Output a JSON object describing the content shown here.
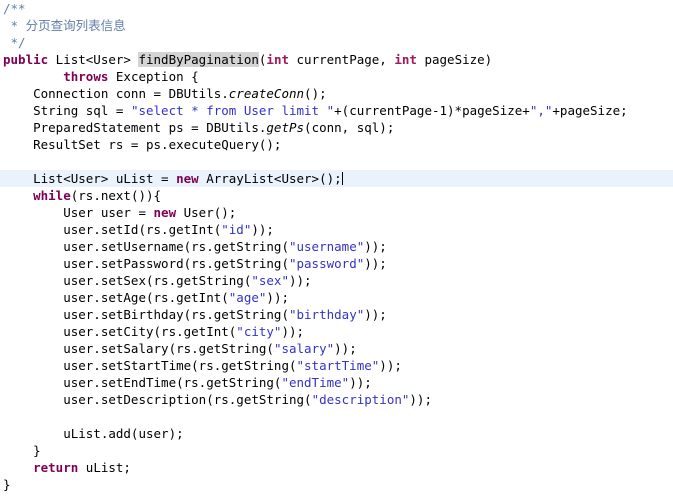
{
  "editor": {
    "language": "java",
    "colors": {
      "background": "#ffffff",
      "foreground": "#000000",
      "keyword": "#7f0055",
      "string": "#3333cc",
      "comment": "#5f7ea8",
      "current_line_highlight": "#eaf2fb",
      "occurrence_highlight": "#d4d4d4"
    },
    "caret_line_index": 10,
    "caret_after_text": ";",
    "occurrence_highlight_token": "findByPagination",
    "lines": [
      {
        "index": 0,
        "indent": 0,
        "current": false,
        "tokens": [
          {
            "t": "comment",
            "v": "/**"
          }
        ]
      },
      {
        "index": 1,
        "indent": 0,
        "current": false,
        "tokens": [
          {
            "t": "comment",
            "v": " * "
          },
          {
            "t": "comment-cjk",
            "v": "分页查询列表信息"
          }
        ]
      },
      {
        "index": 2,
        "indent": 0,
        "current": false,
        "tokens": [
          {
            "t": "comment",
            "v": " */"
          }
        ]
      },
      {
        "index": 3,
        "indent": 0,
        "current": false,
        "tokens": [
          {
            "t": "keyword",
            "v": "public"
          },
          {
            "t": "plain",
            "v": " List<User> "
          },
          {
            "t": "occurrence",
            "v": "findByPagination"
          },
          {
            "t": "plain",
            "v": "("
          },
          {
            "t": "kw2",
            "v": "int"
          },
          {
            "t": "plain",
            "v": " currentPage, "
          },
          {
            "t": "kw2",
            "v": "int"
          },
          {
            "t": "plain",
            "v": " pageSize)"
          }
        ]
      },
      {
        "index": 4,
        "indent": 0,
        "current": false,
        "tokens": [
          {
            "t": "plain",
            "v": "        "
          },
          {
            "t": "keyword",
            "v": "throws"
          },
          {
            "t": "plain",
            "v": " Exception {"
          }
        ]
      },
      {
        "index": 5,
        "indent": 0,
        "current": false,
        "tokens": [
          {
            "t": "plain",
            "v": "    Connection conn = DBUtils."
          },
          {
            "t": "static",
            "v": "createConn"
          },
          {
            "t": "plain",
            "v": "();"
          }
        ]
      },
      {
        "index": 6,
        "indent": 0,
        "current": false,
        "tokens": [
          {
            "t": "plain",
            "v": "    String sql = "
          },
          {
            "t": "string",
            "v": "\"select * from User limit \""
          },
          {
            "t": "plain",
            "v": "+(currentPage-1)*pageSize+"
          },
          {
            "t": "string",
            "v": "\",\""
          },
          {
            "t": "plain",
            "v": "+pageSize;"
          }
        ]
      },
      {
        "index": 7,
        "indent": 0,
        "current": false,
        "tokens": [
          {
            "t": "plain",
            "v": "    PreparedStatement ps = DBUtils."
          },
          {
            "t": "static",
            "v": "getPs"
          },
          {
            "t": "plain",
            "v": "(conn, sql);"
          }
        ]
      },
      {
        "index": 8,
        "indent": 0,
        "current": false,
        "tokens": [
          {
            "t": "plain",
            "v": "    ResultSet rs = ps.executeQuery();"
          }
        ]
      },
      {
        "index": 9,
        "indent": 0,
        "current": false,
        "tokens": [
          {
            "t": "plain",
            "v": ""
          }
        ]
      },
      {
        "index": 10,
        "indent": 0,
        "current": true,
        "tokens": [
          {
            "t": "plain",
            "v": "    List<User> uList = "
          },
          {
            "t": "keyword",
            "v": "new"
          },
          {
            "t": "plain",
            "v": " ArrayList<User>();"
          },
          {
            "t": "caret",
            "v": ""
          }
        ]
      },
      {
        "index": 11,
        "indent": 0,
        "current": false,
        "tokens": [
          {
            "t": "plain",
            "v": "    "
          },
          {
            "t": "keyword",
            "v": "while"
          },
          {
            "t": "plain",
            "v": "(rs.next()){"
          }
        ]
      },
      {
        "index": 12,
        "indent": 0,
        "current": false,
        "tokens": [
          {
            "t": "plain",
            "v": "        User user = "
          },
          {
            "t": "keyword",
            "v": "new"
          },
          {
            "t": "plain",
            "v": " User();"
          }
        ]
      },
      {
        "index": 13,
        "indent": 0,
        "current": false,
        "tokens": [
          {
            "t": "plain",
            "v": "        user.setId(rs.getInt("
          },
          {
            "t": "string",
            "v": "\"id\""
          },
          {
            "t": "plain",
            "v": "));"
          }
        ]
      },
      {
        "index": 14,
        "indent": 0,
        "current": false,
        "tokens": [
          {
            "t": "plain",
            "v": "        user.setUsername(rs.getString("
          },
          {
            "t": "string",
            "v": "\"username\""
          },
          {
            "t": "plain",
            "v": "));"
          }
        ]
      },
      {
        "index": 15,
        "indent": 0,
        "current": false,
        "tokens": [
          {
            "t": "plain",
            "v": "        user.setPassword(rs.getString("
          },
          {
            "t": "string",
            "v": "\"password\""
          },
          {
            "t": "plain",
            "v": "));"
          }
        ]
      },
      {
        "index": 16,
        "indent": 0,
        "current": false,
        "tokens": [
          {
            "t": "plain",
            "v": "        user.setSex(rs.getString("
          },
          {
            "t": "string",
            "v": "\"sex\""
          },
          {
            "t": "plain",
            "v": "));"
          }
        ]
      },
      {
        "index": 17,
        "indent": 0,
        "current": false,
        "tokens": [
          {
            "t": "plain",
            "v": "        user.setAge(rs.getInt("
          },
          {
            "t": "string",
            "v": "\"age\""
          },
          {
            "t": "plain",
            "v": "));"
          }
        ]
      },
      {
        "index": 18,
        "indent": 0,
        "current": false,
        "tokens": [
          {
            "t": "plain",
            "v": "        user.setBirthday(rs.getString("
          },
          {
            "t": "string",
            "v": "\"birthday\""
          },
          {
            "t": "plain",
            "v": "));"
          }
        ]
      },
      {
        "index": 19,
        "indent": 0,
        "current": false,
        "tokens": [
          {
            "t": "plain",
            "v": "        user.setCity(rs.getInt("
          },
          {
            "t": "string",
            "v": "\"city\""
          },
          {
            "t": "plain",
            "v": "));"
          }
        ]
      },
      {
        "index": 20,
        "indent": 0,
        "current": false,
        "tokens": [
          {
            "t": "plain",
            "v": "        user.setSalary(rs.getString("
          },
          {
            "t": "string",
            "v": "\"salary\""
          },
          {
            "t": "plain",
            "v": "));"
          }
        ]
      },
      {
        "index": 21,
        "indent": 0,
        "current": false,
        "tokens": [
          {
            "t": "plain",
            "v": "        user.setStartTime(rs.getString("
          },
          {
            "t": "string",
            "v": "\"startTime\""
          },
          {
            "t": "plain",
            "v": "));"
          }
        ]
      },
      {
        "index": 22,
        "indent": 0,
        "current": false,
        "tokens": [
          {
            "t": "plain",
            "v": "        user.setEndTime(rs.getString("
          },
          {
            "t": "string",
            "v": "\"endTime\""
          },
          {
            "t": "plain",
            "v": "));"
          }
        ]
      },
      {
        "index": 23,
        "indent": 0,
        "current": false,
        "tokens": [
          {
            "t": "plain",
            "v": "        user.setDescription(rs.getString("
          },
          {
            "t": "string",
            "v": "\"description\""
          },
          {
            "t": "plain",
            "v": "));"
          }
        ]
      },
      {
        "index": 24,
        "indent": 0,
        "current": false,
        "tokens": [
          {
            "t": "plain",
            "v": ""
          }
        ]
      },
      {
        "index": 25,
        "indent": 0,
        "current": false,
        "tokens": [
          {
            "t": "plain",
            "v": "        uList.add(user);"
          }
        ]
      },
      {
        "index": 26,
        "indent": 0,
        "current": false,
        "tokens": [
          {
            "t": "plain",
            "v": "    }"
          }
        ]
      },
      {
        "index": 27,
        "indent": 0,
        "current": false,
        "tokens": [
          {
            "t": "plain",
            "v": "    "
          },
          {
            "t": "keyword",
            "v": "return"
          },
          {
            "t": "plain",
            "v": " uList;"
          }
        ]
      },
      {
        "index": 28,
        "indent": 0,
        "current": false,
        "tokens": [
          {
            "t": "plain",
            "v": "}"
          }
        ]
      }
    ]
  }
}
